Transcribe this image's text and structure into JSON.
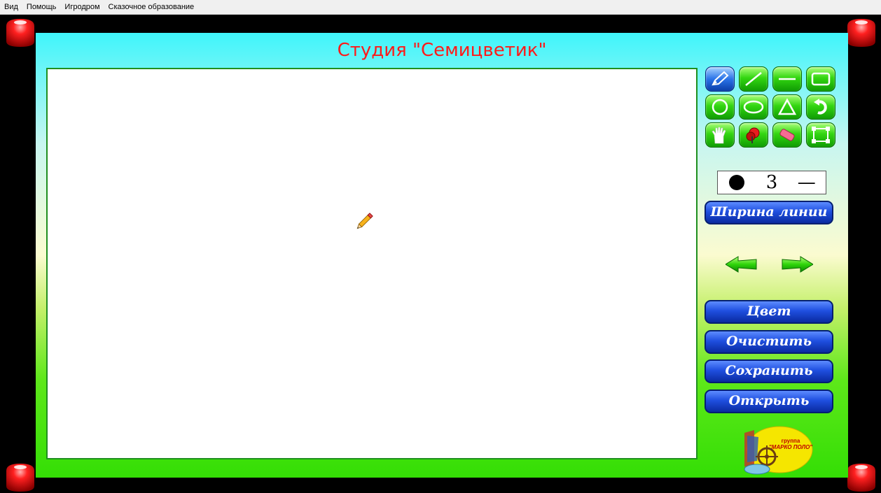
{
  "menu": {
    "items": [
      "Вид",
      "Помощь",
      "Игродром",
      "Сказочное образование"
    ]
  },
  "app": {
    "title": "Студия \"Семицветик\""
  },
  "tools": [
    {
      "name": "pencil-tool",
      "icon": "pencil-icon",
      "active": true
    },
    {
      "name": "line-tool",
      "icon": "diagonal-line-icon"
    },
    {
      "name": "horizontal-line-tool",
      "icon": "horizontal-line-icon"
    },
    {
      "name": "rectangle-tool",
      "icon": "rectangle-icon"
    },
    {
      "name": "circle-tool",
      "icon": "circle-icon"
    },
    {
      "name": "ellipse-tool",
      "icon": "ellipse-icon"
    },
    {
      "name": "triangle-tool",
      "icon": "triangle-icon"
    },
    {
      "name": "undo-tool",
      "icon": "undo-arrow-icon"
    },
    {
      "name": "hand-tool",
      "icon": "hand-icon"
    },
    {
      "name": "fill-tool",
      "icon": "paint-bucket-icon"
    },
    {
      "name": "eraser-tool",
      "icon": "eraser-icon"
    },
    {
      "name": "select-tool",
      "icon": "selection-frame-icon"
    }
  ],
  "status": {
    "color": "#000000",
    "width_value": "3",
    "line_style": "—"
  },
  "buttons": {
    "line_width": "Ширина линии",
    "color": "Цвет",
    "clear": "Очистить",
    "save": "Сохранить",
    "open": "Открыть"
  },
  "logo": {
    "line1": "группа",
    "line2": "\"МАРКО ПОЛО\""
  },
  "colors": {
    "title": "#ff1a1a",
    "tool_green": "#33d611",
    "tool_active_blue": "#2a73e8",
    "button_blue": "#1f4fe0",
    "canvas_border": "#1f8f1f",
    "corner_red": "#e80000"
  }
}
